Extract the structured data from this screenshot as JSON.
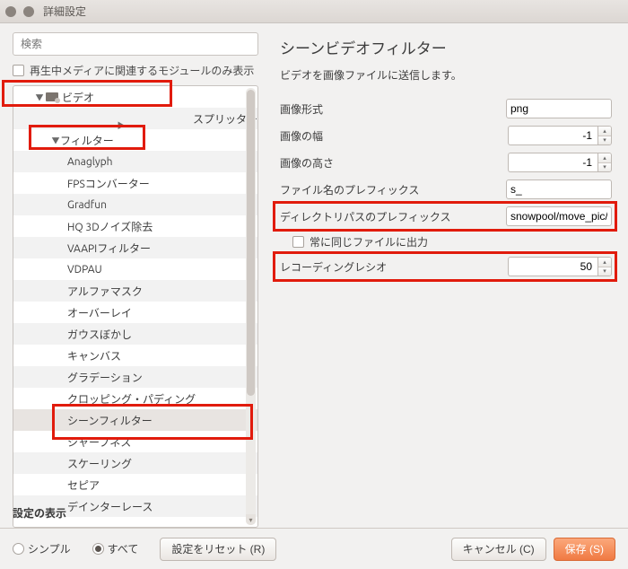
{
  "window_title": "詳細設定",
  "search": {
    "placeholder": "検索"
  },
  "only_playing_modules_label": "再生中メディアに関連するモジュールのみ表示",
  "tree": {
    "video_label": "ビデオ",
    "splitter_label": "スプリッター",
    "filter_label": "フィルター",
    "filters": [
      "Anaglyph",
      "FPSコンバーター",
      "Gradfun",
      "HQ 3Dノイズ除去",
      "VAAPIフィルター",
      "VDPAU",
      "アルファマスク",
      "オーバーレイ",
      "ガウスぼかし",
      "キャンバス",
      "グラデーション",
      "クロッピング・パディング",
      "シーンフィルター",
      "シャープネス",
      "スケーリング",
      "セピア",
      "デインターレース"
    ],
    "selected_index": 12
  },
  "right": {
    "title": "シーンビデオフィルター",
    "desc": "ビデオを画像ファイルに送信します。",
    "fields": {
      "image_format_label": "画像形式",
      "image_format_value": "png",
      "image_width_label": "画像の幅",
      "image_width_value": "-1",
      "image_height_label": "画像の高さ",
      "image_height_value": "-1",
      "filename_prefix_label": "ファイル名のプレフィックス",
      "filename_prefix_value": "s_",
      "dir_prefix_label": "ディレクトリパスのプレフィックス",
      "dir_prefix_value": "snowpool/move_pic/",
      "always_same_file_label": "常に同じファイルに出力",
      "recording_ratio_label": "レコーディングレシオ",
      "recording_ratio_value": "50"
    }
  },
  "bottom": {
    "display_settings_label": "設定の表示",
    "simple_label": "シンプル",
    "all_label": "すべて",
    "reset_label": "設定をリセット (R)",
    "cancel_label": "キャンセル (C)",
    "save_label": "保存 (S)"
  }
}
